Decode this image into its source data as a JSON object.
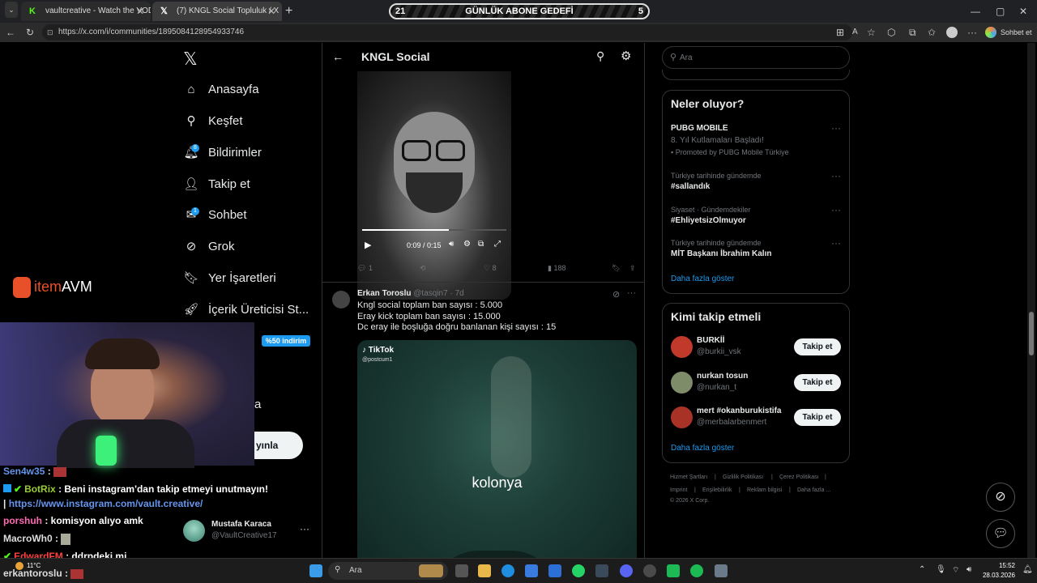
{
  "browser": {
    "tabs": [
      {
        "title": "vaultcreative - Watch the VOD on",
        "active": false
      },
      {
        "title": "(7) KNGL Social Topluluk / X",
        "active": true
      }
    ],
    "url": "https://x.com/i/communities/1895084128954933746",
    "chat_button": "Sohbet et"
  },
  "goal": {
    "left": "21",
    "label": "GÜNLÜK ABONE GEDEFİ",
    "right": "5"
  },
  "sidebar": {
    "items": [
      {
        "label": "Anasayfa",
        "icon": "home-icon"
      },
      {
        "label": "Keşfet",
        "icon": "search-icon"
      },
      {
        "label": "Bildirimler",
        "icon": "bell-icon",
        "badge": "8"
      },
      {
        "label": "Takip et",
        "icon": "person-add-icon"
      },
      {
        "label": "Sohbet",
        "icon": "mail-icon",
        "badge": "1"
      },
      {
        "label": "Grok",
        "icon": "grok-icon"
      },
      {
        "label": "Yer İşaretleri",
        "icon": "bookmark-icon"
      },
      {
        "label": "İçerik Üreticisi St...",
        "icon": "rocket-icon"
      }
    ],
    "discount": "%50 indirim",
    "partial_label": "a",
    "post_button_partial": "yınla",
    "account": {
      "name": "Mustafa Karaca",
      "handle": "@VaultCreative17"
    }
  },
  "overlay": {
    "brand": "itemAVM"
  },
  "header": {
    "title": "KNGL Social"
  },
  "video": {
    "time": "0:09 / 0:15",
    "progress": 0.6
  },
  "tweet1_actions": {
    "replies": "1",
    "likes": "8",
    "views": "188"
  },
  "tweet2": {
    "name": "Erkan Toroslu",
    "meta": "@tasqin7 · 7d",
    "lines": [
      "Kngl social toplam ban sayısı : 5.000",
      "Eray kick toplam ban sayısı : 15.000",
      "Dc eray ile boşluğa doğru banlanan kişi sayısı : 15"
    ],
    "tiktok_label": "TikTok",
    "tiktok_user": "@postcum1",
    "caption": "kolonya"
  },
  "search": {
    "placeholder": "Ara"
  },
  "trends": {
    "title": "Neler oluyor?",
    "items": [
      {
        "context": "",
        "name": "PUBG MOBILE",
        "sub": "8. Yıl Kutlamaları Başladı!",
        "promo": "Promoted by PUBG Mobile Türkiye"
      },
      {
        "context": "Türkiye tarihinde gündemde",
        "name": "#sallandık"
      },
      {
        "context": "Siyaset · Gündemdekiler",
        "name": "#EhliyetsizOlmuyor"
      },
      {
        "context": "Türkiye tarihinde gündemde",
        "name": "MİT Başkanı İbrahim Kalın"
      }
    ],
    "more": "Daha fazla göster"
  },
  "who_to_follow": {
    "title": "Kimi takip etmeli",
    "users": [
      {
        "name": "BURKİİ",
        "handle": "@burkii_vsk",
        "color": "#c0392b"
      },
      {
        "name": "nurkan tosun",
        "handle": "@nurkan_t",
        "color": "#7f8c6a"
      },
      {
        "name": "mert #okanburukistifa",
        "handle": "@merbalarbenmert",
        "color": "#a93226"
      }
    ],
    "button": "Takip et",
    "more": "Daha fazla göster"
  },
  "footer": {
    "links": [
      "Hizmet Şartları",
      "Gizlilik Politikası",
      "Çerez Politikası",
      "Imprint",
      "Erişilebilirlik",
      "Reklam bilgisi",
      "Daha fazla ..."
    ],
    "copyright": "© 2026 X Corp."
  },
  "chat": [
    {
      "user": "Sen4w35",
      "color": "#6495ed",
      "msg": ":"
    },
    {
      "user": "BotRix",
      "color": "#9acd32",
      "msg": ": Beni instagram'dan takip etmeyi unutmayın!"
    },
    {
      "user": "",
      "color": "#6495ed",
      "msg": "https://www.instagram.com/vault.creative/"
    },
    {
      "user": "porshuh",
      "color": "#ff69b4",
      "msg": ": komisyon alıyo amk"
    },
    {
      "user": "MacroWh0",
      "color": "#dddddd",
      "msg": ":"
    },
    {
      "user": "EdwardFM",
      "color": "#ff4040",
      "msg": ": ddrpdeki mi"
    },
    {
      "user": "erkantoroslu",
      "color": "#dddddd",
      "msg": ":"
    }
  ],
  "taskbar": {
    "search": "Ara",
    "weather": "11°C",
    "time": "15:52",
    "date": "28.03.2026"
  },
  "colors": {
    "accent": "#1d9bf0",
    "bg": "#000000",
    "border": "#2f3336"
  }
}
